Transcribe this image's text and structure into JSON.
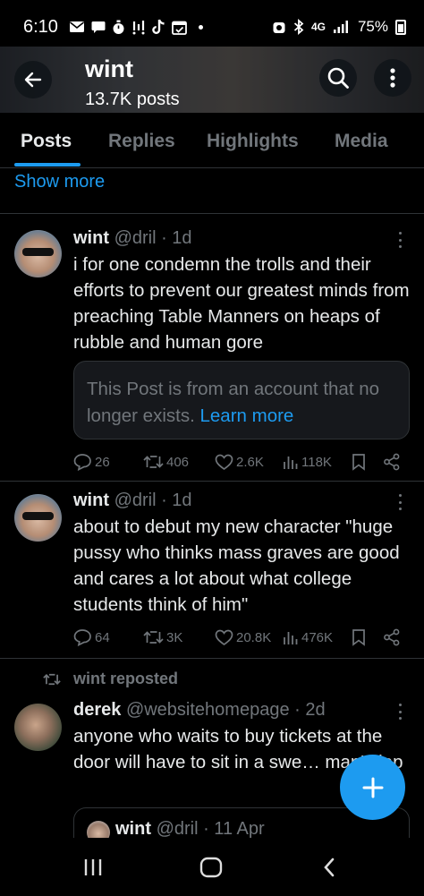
{
  "status_bar": {
    "time": "6:10",
    "network": "4G",
    "battery": "75%"
  },
  "header": {
    "title": "wint",
    "subtitle": "13.7K posts"
  },
  "tabs": [
    {
      "label": "Posts",
      "active": true
    },
    {
      "label": "Replies",
      "active": false
    },
    {
      "label": "Highlights",
      "active": false
    },
    {
      "label": "Media",
      "active": false
    }
  ],
  "show_more": "Show more",
  "posts": [
    {
      "name": "wint",
      "meta": "@dril · 1d",
      "text": "i for one condemn the trolls and their efforts to prevent our greatest minds from preaching Table Manners on heaps of rubble and human gore",
      "quote_notice": "This Post is from an account that no longer exists.",
      "quote_link": "Learn more",
      "replies": "26",
      "reposts": "406",
      "likes": "2.6K",
      "views": "118K"
    },
    {
      "name": "wint",
      "meta": "@dril · 1d",
      "text": "about to debut my new character \"huge pussy who thinks mass graves are good and cares a lot about what college students think of him\"",
      "replies": "64",
      "reposts": "3K",
      "likes": "20.8K",
      "views": "476K"
    },
    {
      "repost_label": "wint reposted",
      "name": "derek",
      "meta": "@websitehomepage · 2d",
      "text": "anyone who waits to buy tickets at the door will have to sit in a swe… man's lap",
      "quote": {
        "name": "wint",
        "meta": "@dril · 11 Apr"
      }
    }
  ],
  "colors": {
    "accent": "#1d9bf0",
    "muted": "#71767b",
    "divider": "#2f3336"
  }
}
